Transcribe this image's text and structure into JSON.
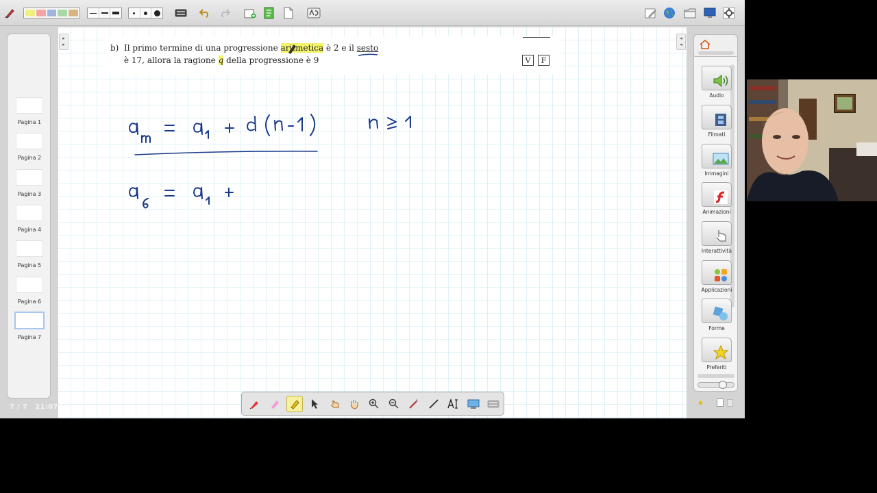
{
  "toolbar": {
    "items": [
      "pen-tool-icon",
      "color-swatches",
      "line-width",
      "dot-size",
      "keyboard-icon",
      "undo-icon",
      "redo-icon",
      "new-page-icon",
      "import-icon",
      "document-icon",
      "recognize-icon",
      "pen-settings-icon",
      "globe-icon",
      "folder-icon",
      "display-icon",
      "settings-icon"
    ],
    "swatch_colors": [
      "#f0f080",
      "#f4a4a4",
      "#9eb4dc",
      "#a8d8a8",
      "#d8b480"
    ]
  },
  "pages": {
    "items": [
      {
        "label": "Pagina 1"
      },
      {
        "label": "Pagina 2"
      },
      {
        "label": "Pagina 3"
      },
      {
        "label": "Pagina 4"
      },
      {
        "label": "Pagina 5"
      },
      {
        "label": "Pagina 6"
      },
      {
        "label": "Pagina 7"
      }
    ],
    "active_index": 6,
    "counter": "7 / 7",
    "time": "21:07"
  },
  "document": {
    "item_marker": "b)",
    "line1_before": "Il primo termine di una progressione ",
    "line1_highlight": "aritmetica",
    "line1_middle": " è 2 e il ",
    "line1_underlined": "sesto",
    "line2_before": "è 17, allora la ragione ",
    "line2_highlight": "q",
    "line2_after": " della progressione è 9",
    "true_label": "V",
    "false_label": "F"
  },
  "handwriting": {
    "formula_general": "a_n = a_1 + d(n-1)",
    "condition": "n ≥ 1",
    "formula_specific": "a_6 = a_1 +",
    "ink_color": "#1a3a8c"
  },
  "floating_tools": [
    "pen-icon",
    "highlighter-pen-icon",
    "highlighter-icon",
    "select-arrow-icon",
    "pointer-hand-icon",
    "pan-hand-icon",
    "zoom-in-icon",
    "zoom-out-icon",
    "magic-wand-icon",
    "line-icon",
    "text-icon",
    "screen-capture-icon",
    "keyboard-icon"
  ],
  "gallery": {
    "items": [
      {
        "label": "Audio",
        "icon": "speaker-icon"
      },
      {
        "label": "Filmati",
        "icon": "film-icon"
      },
      {
        "label": "Immagini",
        "icon": "image-icon"
      },
      {
        "label": "Animazioni",
        "icon": "flash-icon"
      },
      {
        "label": "Interattività",
        "icon": "hand-cursor-icon"
      },
      {
        "label": "Applicazioni",
        "icon": "apps-icon"
      },
      {
        "label": "Forme",
        "icon": "shapes-icon"
      },
      {
        "label": "Preferiti",
        "icon": "star-icon"
      }
    ]
  }
}
